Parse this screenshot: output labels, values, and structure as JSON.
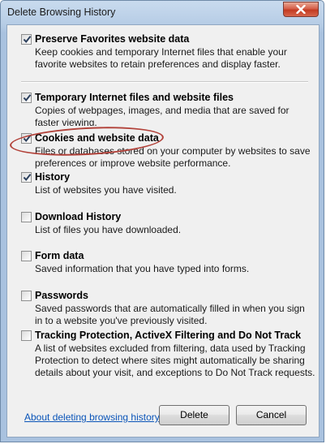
{
  "window": {
    "title": "Delete Browsing History"
  },
  "options": [
    {
      "id": "preserve-favorites",
      "label": "Preserve Favorites website data",
      "checked": true,
      "description": "Keep cookies and temporary Internet files that enable your favorite websites to retain preferences and display faster."
    },
    {
      "id": "temporary-internet-files",
      "label": "Temporary Internet files and website files",
      "checked": true,
      "description": "Copies of webpages, images, and media that are saved for faster viewing."
    },
    {
      "id": "cookies",
      "label": "Cookies and website data",
      "checked": true,
      "description": "Files or databases stored on your computer by websites to save preferences or improve website performance."
    },
    {
      "id": "history",
      "label": "History",
      "checked": true,
      "description": "List of websites you have visited."
    },
    {
      "id": "download-history",
      "label": "Download History",
      "checked": false,
      "description": "List of files you have downloaded."
    },
    {
      "id": "form-data",
      "label": "Form data",
      "checked": false,
      "description": "Saved information that you have typed into forms."
    },
    {
      "id": "passwords",
      "label": "Passwords",
      "checked": false,
      "description": "Saved passwords that are automatically filled in when you sign in to a website you've previously visited."
    },
    {
      "id": "tracking-protection",
      "label": "Tracking Protection, ActiveX Filtering and Do Not Track",
      "checked": false,
      "description": "A list of websites excluded from filtering, data used by Tracking Protection to detect where sites might automatically be sharing details about your visit, and exceptions to Do Not Track requests."
    }
  ],
  "footer": {
    "link_text": "About deleting browsing history",
    "delete_label": "Delete",
    "cancel_label": "Cancel"
  },
  "colors": {
    "link": "#0a54b8",
    "highlight": "#b2423a",
    "close": "#c33b22"
  },
  "icons": {
    "close": "close-x-icon",
    "check": "checkmark-icon"
  }
}
